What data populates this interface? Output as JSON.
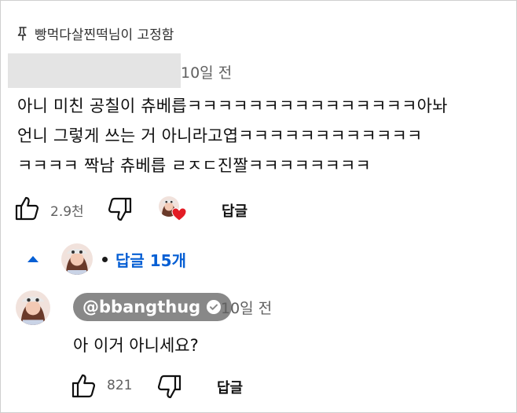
{
  "pinned": {
    "label": "빵먹다살찐떡님이 고정함"
  },
  "comment": {
    "time": "10일 전",
    "lines": [
      "아니 미친 공칠이 츄베릅ㅋㅋㅋㅋㅋㅋㅋㅋㅋㅋㅋㅋㅋㅋㅋ아놔",
      "언니 그렇게 쓰는 거 아니라고엽ㅋㅋㅋㅋㅋㅋㅋㅋㅋㅋㅋㅋ",
      "ㅋㅋㅋㅋ 짝남 츄베릅 ㄹㅈㄷ진짤ㅋㅋㅋㅋㅋㅋㅋㅋ"
    ],
    "like_count": "2.9천",
    "reply_label": "답글"
  },
  "replies_toggle": {
    "label": "답글 15개"
  },
  "reply": {
    "author": "@bbangthug",
    "time": "10일 전",
    "text": "아 이거 아니세요?",
    "like_count": "821",
    "reply_label": "답글"
  },
  "icons": {
    "pin": "pin-icon",
    "like": "thumbs-up-icon",
    "dislike": "thumbs-down-icon",
    "heart": "heart-icon",
    "chevron": "chevron-up-icon",
    "verified": "check-icon"
  },
  "colors": {
    "link": "#065fd4",
    "heart": "#e31c25",
    "badge": "#888888",
    "secondary": "#606060"
  }
}
